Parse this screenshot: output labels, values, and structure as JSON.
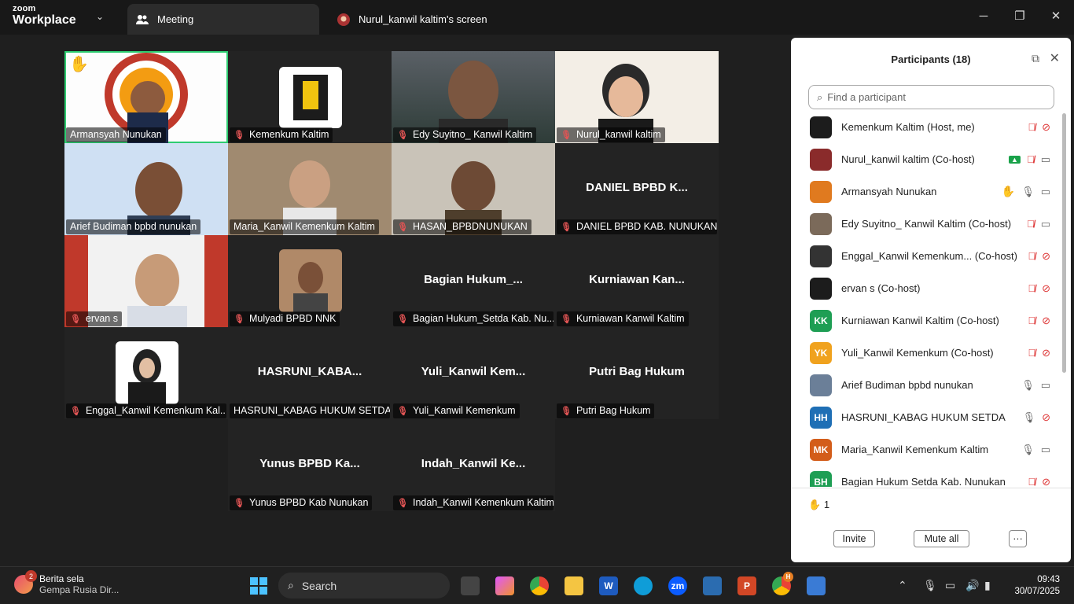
{
  "app": {
    "logo_top": "zoom",
    "logo_bottom": "Workplace"
  },
  "tabs": {
    "meeting": "Meeting",
    "share": "Nurul_kanwil kaltim's screen"
  },
  "tiles": [
    {
      "name": "Armansyah Nunukan",
      "big": "",
      "muted": false
    },
    {
      "name": "Kemenkum Kaltim",
      "big": "",
      "muted": true
    },
    {
      "name": "Edy Suyitno_ Kanwil Kaltim",
      "big": "",
      "muted": true
    },
    {
      "name": "Nurul_kanwil kaltim",
      "big": "",
      "muted": true
    },
    {
      "name": "Arief Budiman bpbd nunukan",
      "big": "",
      "muted": false
    },
    {
      "name": "Maria_Kanwil Kemenkum Kaltim",
      "big": "",
      "muted": false
    },
    {
      "name": "HASAN_BPBDNUNUKAN",
      "big": "",
      "muted": true
    },
    {
      "name": "DANIEL BPBD KAB. NUNUKAN",
      "big": "DANIEL BPBD K...",
      "muted": true
    },
    {
      "name": "ervan s",
      "big": "",
      "muted": true
    },
    {
      "name": "Mulyadi BPBD NNK",
      "big": "",
      "muted": true
    },
    {
      "name": "Bagian Hukum_Setda Kab. Nu...",
      "big": "Bagian  Hukum_...",
      "muted": true
    },
    {
      "name": "Kurniawan Kanwil Kaltim",
      "big": "Kurniawan  Kan...",
      "muted": true
    },
    {
      "name": "Enggal_Kanwil Kemenkum Kal...",
      "big": "",
      "muted": true
    },
    {
      "name": "HASRUNI_KABAG HUKUM SETDA",
      "big": "HASRUNI_KABA...",
      "muted": false
    },
    {
      "name": "Yuli_Kanwil Kemenkum",
      "big": "Yuli_Kanwil  Kem...",
      "muted": true
    },
    {
      "name": "Putri Bag Hukum",
      "big": "Putri Bag Hukum",
      "muted": true
    },
    {
      "name": "Yunus BPBD Kab Nunukan",
      "big": "Yunus BPBD Ka...",
      "muted": true
    },
    {
      "name": "Indah_Kanwil Kemenkum Kaltim",
      "big": "Indah_Kanwil  Ke...",
      "muted": true
    }
  ],
  "panel": {
    "title": "Participants (18)",
    "search_placeholder": "Find a participant",
    "participants": [
      {
        "name": "Kemenkum Kaltim (Host, me)",
        "avatar": "",
        "color": "#1c1c1c",
        "icons": [
          "mic-muted",
          "video-off"
        ]
      },
      {
        "name": "Nurul_kanwil kaltim (Co-host)",
        "avatar": "",
        "color": "#8a2b2b",
        "icons": [
          "share",
          "mic-muted",
          "video-on"
        ]
      },
      {
        "name": "Armansyah Nunukan",
        "avatar": "",
        "color": "#e07a1f",
        "icons": [
          "hand",
          "mic-on",
          "video-on"
        ]
      },
      {
        "name": "Edy Suyitno_ Kanwil Kaltim (Co-host)",
        "avatar": "",
        "color": "#7b6a5a",
        "icons": [
          "mic-muted",
          "video-on"
        ]
      },
      {
        "name": "Enggal_Kanwil Kemenkum... (Co-host)",
        "avatar": "",
        "color": "#333333",
        "icons": [
          "mic-muted",
          "video-off"
        ]
      },
      {
        "name": "ervan s (Co-host)",
        "avatar": "",
        "color": "#1c1c1c",
        "icons": [
          "mic-muted",
          "video-off"
        ]
      },
      {
        "name": "Kurniawan Kanwil Kaltim (Co-host)",
        "avatar": "KK",
        "color": "#1e9e54",
        "icons": [
          "mic-muted",
          "video-off"
        ]
      },
      {
        "name": "Yuli_Kanwil Kemenkum (Co-host)",
        "avatar": "YK",
        "color": "#f0a21e",
        "icons": [
          "mic-muted",
          "video-off"
        ]
      },
      {
        "name": "Arief Budiman bpbd nunukan",
        "avatar": "",
        "color": "#6b7f98",
        "icons": [
          "mic-on",
          "video-on"
        ]
      },
      {
        "name": "HASRUNI_KABAG HUKUM SETDA",
        "avatar": "HH",
        "color": "#1f6fb5",
        "icons": [
          "mic-on",
          "video-off"
        ]
      },
      {
        "name": "Maria_Kanwil Kemenkum Kaltim",
        "avatar": "MK",
        "color": "#d35d1a",
        "icons": [
          "mic-on",
          "video-on"
        ]
      },
      {
        "name": "Bagian Hukum Setda Kab. Nunukan",
        "avatar": "BH",
        "color": "#1e9e54",
        "icons": [
          "mic-muted",
          "video-off"
        ]
      }
    ],
    "raised_hands": "1",
    "invite": "Invite",
    "mute_all": "Mute all",
    "more": "···"
  },
  "taskbar": {
    "news_badge": "2",
    "news_title": "Berita sela",
    "news_sub": "Gempa Rusia Dir...",
    "search": "Search",
    "chrome_badge": "H",
    "time": "09:43",
    "date": "30/07/2025"
  },
  "colors": {
    "speaker_outline": "#2ecc71",
    "mute": "#e05454",
    "accent": "#0b5cff"
  }
}
